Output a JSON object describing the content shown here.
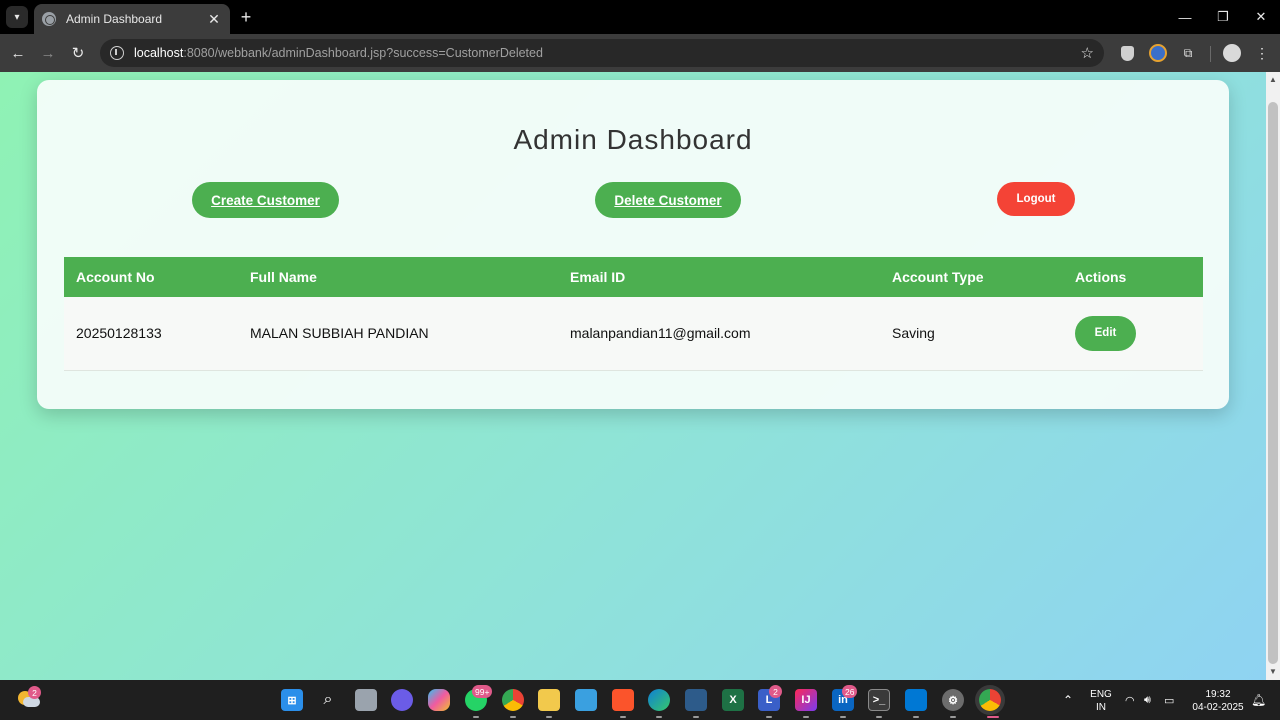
{
  "browser": {
    "tab_title": "Admin Dashboard",
    "url_host": "localhost",
    "url_rest": ":8080/webbank/adminDashboard.jsp?success=CustomerDeleted"
  },
  "page": {
    "title": "Admin Dashboard",
    "buttons": {
      "create": "Create Customer",
      "delete": "Delete Customer",
      "logout": "Logout"
    },
    "table": {
      "headers": [
        "Account No",
        "Full Name",
        "Email ID",
        "Account Type",
        "Actions"
      ],
      "rows": [
        {
          "account_no": "20250128133",
          "full_name": "MALAN SUBBIAH PANDIAN",
          "email": "malanpandian11@gmail.com",
          "account_type": "Saving",
          "action": "Edit"
        }
      ]
    }
  },
  "taskbar": {
    "weather_badge": "2",
    "whatsapp_badge": "99+",
    "lens_badge": "2",
    "linkedin_badge": "26",
    "lang_line1": "ENG",
    "lang_line2": "IN",
    "time": "19:32",
    "date": "04-02-2025"
  },
  "colors": {
    "accent_green": "#4caf50",
    "logout_red": "#f44336"
  }
}
